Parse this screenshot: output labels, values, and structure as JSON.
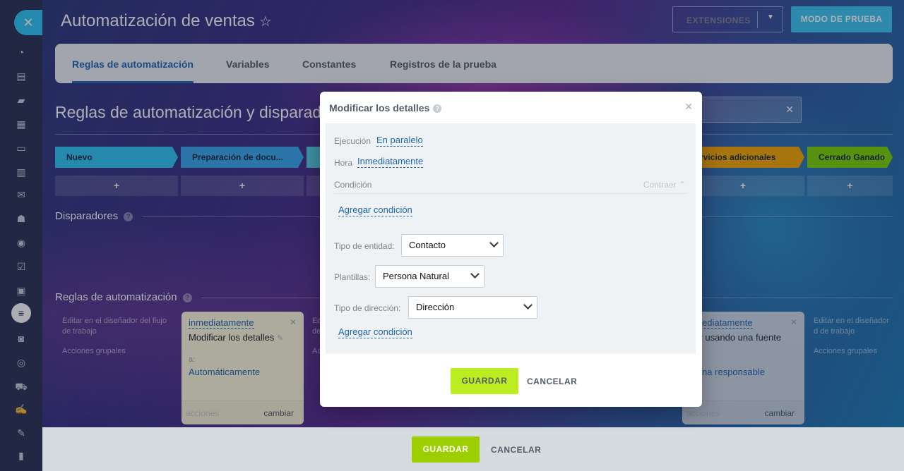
{
  "sidebar": {
    "close_icon": "close-icon"
  },
  "header": {
    "title": "Automatización de ventas",
    "extensions_label": "EXTENSIONES",
    "test_mode_label": "MODO DE PRUEBA"
  },
  "tabs": [
    {
      "label": "Reglas de automatización"
    },
    {
      "label": "Variables"
    },
    {
      "label": "Constantes"
    },
    {
      "label": "Registros de la prueba"
    }
  ],
  "page": {
    "section_title": "Reglas de automatización y disparad",
    "triggers_title": "Disparadores",
    "rules_title": "Reglas de automatización"
  },
  "stages": [
    {
      "label": "Nuevo",
      "color": "#2fc6f6"
    },
    {
      "label": "Preparación de docu...",
      "color": "#39a8ef"
    },
    {
      "label": "rvicios adicionales",
      "color": "#f7a700"
    },
    {
      "label": "Cerrado Ganado",
      "color": "#7bd500"
    }
  ],
  "plus_label": "+",
  "columns": {
    "left_note": "Editar en el diseñador del flujo de trabajo",
    "left_group": "Acciones grupales",
    "right_note": "Editar en el diseñador d de trabajo",
    "right_group": "Acciones grupales",
    "mid_note_a": "Ed de",
    "mid_note_b": "Ac"
  },
  "cards": [
    {
      "when": "inmediatamente",
      "action": "Modificar los detalles",
      "to_label": "a:",
      "to_value": "Automáticamente",
      "footer_left": "acciones",
      "footer_right": "cambiar"
    },
    {
      "when": "nmediatamente",
      "action": "ear usando una fuente",
      "to_value": "rsona responsable",
      "footer_left": "acciones",
      "footer_right": "cambiar"
    }
  ],
  "bottom": {
    "save_label": "GUARDAR",
    "cancel_label": "CANCELAR"
  },
  "modal": {
    "title": "Modificar los detalles",
    "execution_label": "Ejecución",
    "execution_value": "En paralelo",
    "time_label": "Hora",
    "time_value": "Inmediatamente",
    "condition_label": "Condición",
    "collapse_label": "Contraer",
    "add_condition_1": "Agregar condición",
    "entity_label": "Tipo de entidad:",
    "entity_value": "Contacto",
    "templates_label": "Plantillas:",
    "templates_value": "Persona Natural",
    "address_label": "Tipo de dirección:",
    "address_value": "Dirección",
    "add_condition_2": "Agregar condición",
    "save_label": "GUARDAR",
    "cancel_label": "CANCELAR"
  }
}
